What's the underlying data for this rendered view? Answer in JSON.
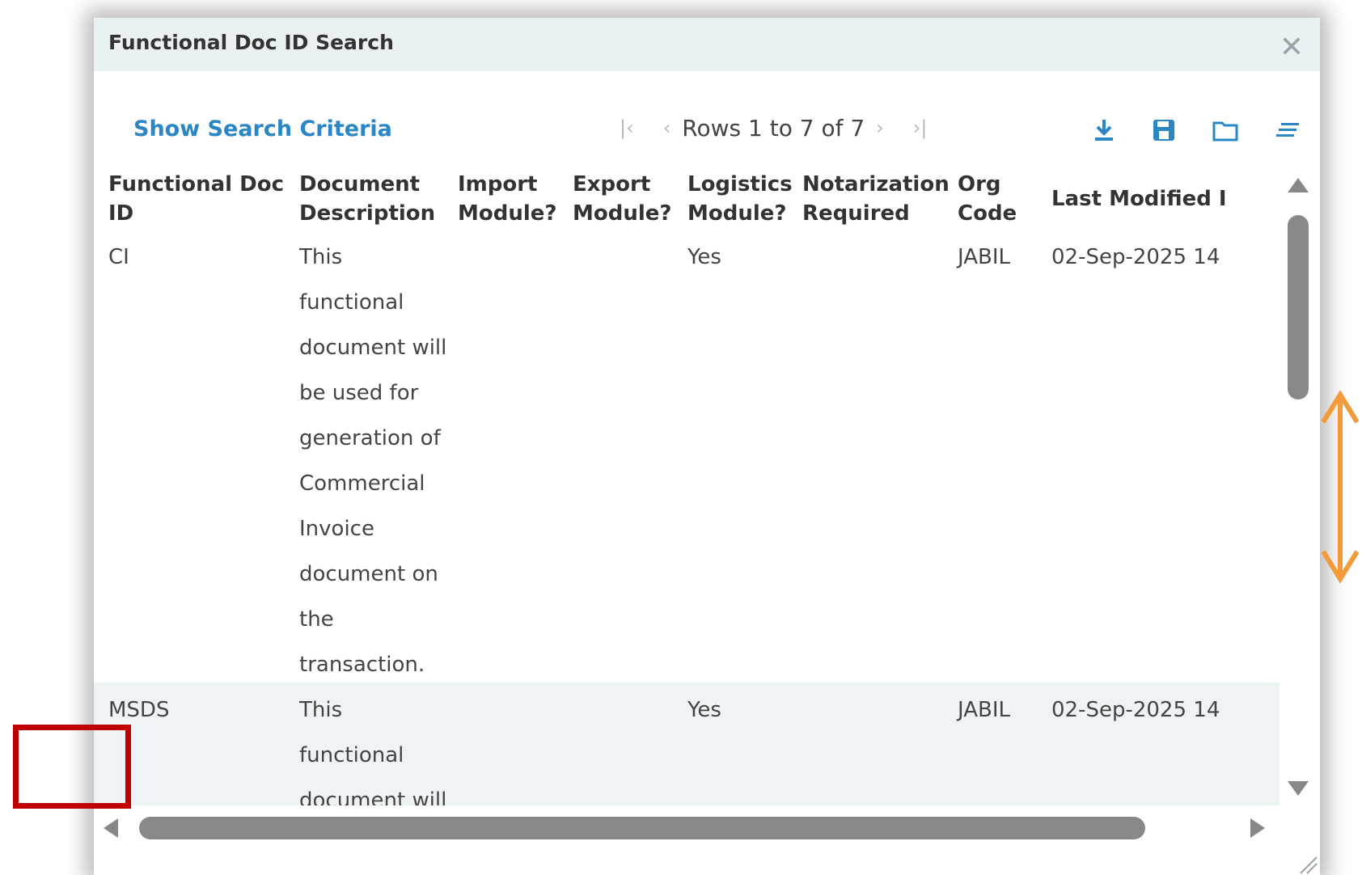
{
  "dialog": {
    "title": "Functional Doc ID Search"
  },
  "toolbar": {
    "show_criteria": "Show Search Criteria",
    "pager": {
      "rows_text": "Rows 1 to 7 of 7"
    }
  },
  "grid": {
    "headers": {
      "col1": [
        "Functional Doc",
        "ID"
      ],
      "col2": [
        "Document",
        "Description"
      ],
      "col3": [
        "Import",
        "Module?"
      ],
      "col4": [
        "Export",
        "Module?"
      ],
      "col5": [
        "Logistics",
        "Module?"
      ],
      "col6": [
        "Notarization",
        "Required"
      ],
      "col7": [
        "Org",
        "Code"
      ],
      "col8": "Last Modified I"
    },
    "rows": [
      {
        "id": "CI",
        "description_lines": [
          "This",
          "functional",
          "document will",
          "be used for",
          "generation of",
          "Commercial",
          "Invoice",
          "document on",
          "the",
          "transaction."
        ],
        "import": "",
        "export": "",
        "logistics": "Yes",
        "notarization": "",
        "org_code": "JABIL",
        "last_modified": "02-Sep-2025 14"
      },
      {
        "id": "MSDS",
        "description_lines": [
          "This",
          "functional",
          "document will"
        ],
        "import": "",
        "export": "",
        "logistics": "Yes",
        "notarization": "",
        "org_code": "JABIL",
        "last_modified": "02-Sep-2025 14"
      }
    ]
  },
  "colors": {
    "accent": "#2a86c4",
    "annotation_red": "#c00000",
    "annotation_orange": "#f39a3b",
    "titlebar": "#e9f1f4"
  },
  "icons": [
    "close-icon",
    "first-page-icon",
    "prev-page-icon",
    "next-page-icon",
    "last-page-icon",
    "download-icon",
    "save-icon",
    "folder-icon",
    "columns-icon"
  ]
}
